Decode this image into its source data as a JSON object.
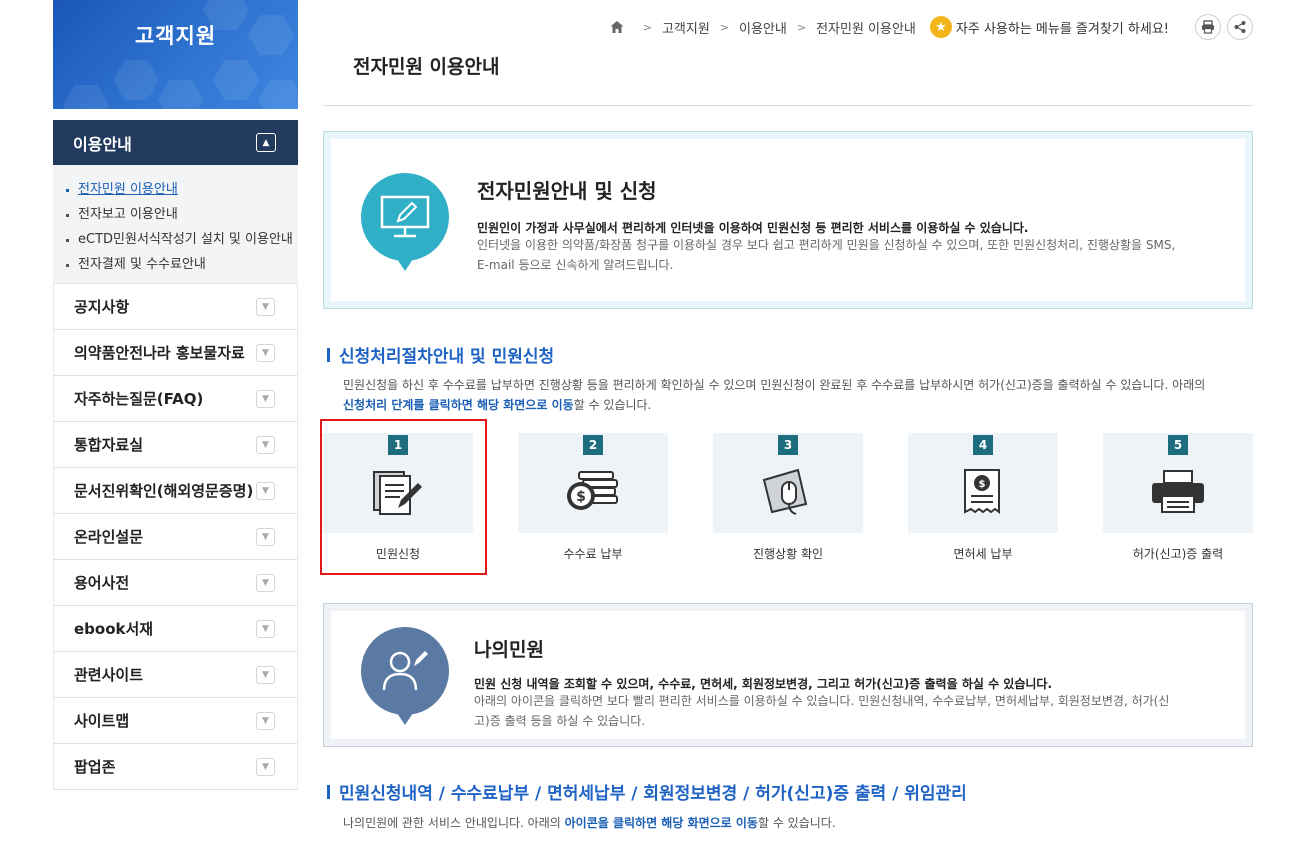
{
  "sidebar": {
    "banner_title": "고객지원",
    "section_title": "이용안내",
    "sub_items": [
      "전자민원 이용안내",
      "전자보고 이용안내",
      "eCTD민원서식작성기 설치 및 이용안내",
      "전자결제 및 수수료안내"
    ],
    "menu": [
      "공지사항",
      "의약품안전나라 홍보물자료",
      "자주하는질문(FAQ)",
      "통합자료실",
      "문서진위확인(해외영문증명)",
      "온라인설문",
      "용어사전",
      "ebook서재",
      "관련사이트",
      "사이트맵",
      "팝업존"
    ]
  },
  "breadcrumb": [
    "고객지원",
    "이용안내",
    "전자민원 이용안내"
  ],
  "favorite_text": "자주 사용하는 메뉴를 즐겨찾기 하세요!",
  "page_title": "전자민원 이용안내",
  "info1": {
    "title": "전자민원안내 및 신청",
    "strong": "민원인이 가정과 사무실에서 편리하게 인터넷을 이용하여 민원신청 등 편리한 서비스를 이용하실 수 있습니다.",
    "desc1": "인터넷을 이용한 의약품/화장품 청구를 이용하실 경우 보다 쉽고 편리하게 민원을 신청하실 수 있으며, 또한 민원신청처리, 진행상황을 SMS,",
    "desc2": "E-mail 등으로 신속하게 알려드립니다."
  },
  "section1": {
    "heading": "신청처리절차안내 및 민원신청",
    "p1": "민원신청을 하신 후 수수료를 납부하면 진행상황 등을 편리하게 확인하실 수 있으며 민원신청이 완료된 후 수수료를 납부하시면 허가(신고)증을 출력하실 수 있습니다. 아래의",
    "p2_bold": "신청처리 단계를 클릭하면 해당 화면으로 이동",
    "p2_rest": "할 수 있습니다."
  },
  "steps": [
    {
      "num": "1",
      "label": "민원신청",
      "icon": "document-pen-icon"
    },
    {
      "num": "2",
      "label": "수수료 납부",
      "icon": "coins-icon"
    },
    {
      "num": "3",
      "label": "진행상황 확인",
      "icon": "mouse-click-icon"
    },
    {
      "num": "4",
      "label": "면허세 납부",
      "icon": "receipt-icon"
    },
    {
      "num": "5",
      "label": "허가(신고)증 출력",
      "icon": "printer-icon"
    }
  ],
  "info2": {
    "title": "나의민원",
    "strong": "민원 신청 내역을 조회할 수 있으며, 수수료, 면허세, 회원정보변경, 그리고 허가(신고)증 출력을 하실 수 있습니다.",
    "desc1": "아래의 아이콘을 클릭하면 보다 빨리 편리한 서비스를 이용하실 수 있습니다. 민원신청내역, 수수료납부, 면허세납부, 회원정보변경, 허가(신",
    "desc2": "고)증 출력 등을 하실 수 있습니다."
  },
  "section2": {
    "heading": "민원신청내역 / 수수료납부 / 면허세납부 / 회원정보변경 / 허가(신고)증 출력 / 위임관리",
    "p_pre": "나의민원에 관한 서비스 안내입니다. 아래의 ",
    "p_bold": "아이콘을 클릭하면 해당 화면으로 이동",
    "p_post": "할 수 있습니다."
  },
  "colors": {
    "accent": "#1f63c4",
    "sidebar_dark": "#223a5e",
    "bubble1": "#2fb0c6",
    "bubble2": "#5a7aa4",
    "step_num": "#1d6d7e",
    "highlight": "#e01818"
  }
}
